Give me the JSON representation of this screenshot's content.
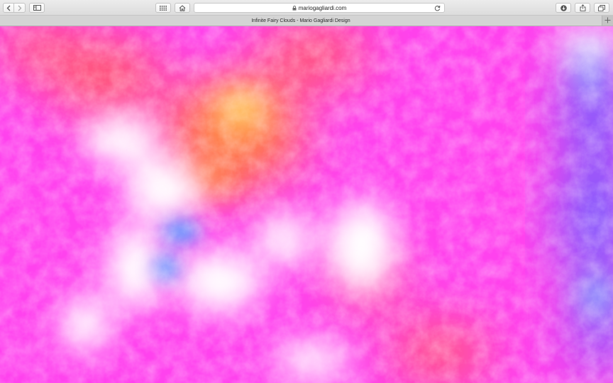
{
  "browser": {
    "address": {
      "url_text": "mariogagliardi.com"
    },
    "tab": {
      "title": "Infinite Fairy Clouds - Mario Gagliardi Design"
    },
    "icons": {
      "back": "chevron-left-icon",
      "forward": "chevron-right-icon",
      "sidebar": "sidebar-icon",
      "top_sites": "grid-icon",
      "home": "home-icon",
      "lock": "lock-icon",
      "reload": "reload-icon",
      "download": "download-icon",
      "share": "share-icon",
      "tabs": "tabs-overview-icon",
      "new_tab": "plus-icon"
    }
  },
  "page": {
    "colors": {
      "base_magenta": "#ff42ee",
      "white": "#ffffff",
      "orange": "#ff7a3a",
      "coral": "#ff5a6a",
      "yellow": "#ffe070",
      "blue": "#6aa0ff",
      "violet": "#7060ff",
      "sky": "#7fd0ff"
    }
  }
}
